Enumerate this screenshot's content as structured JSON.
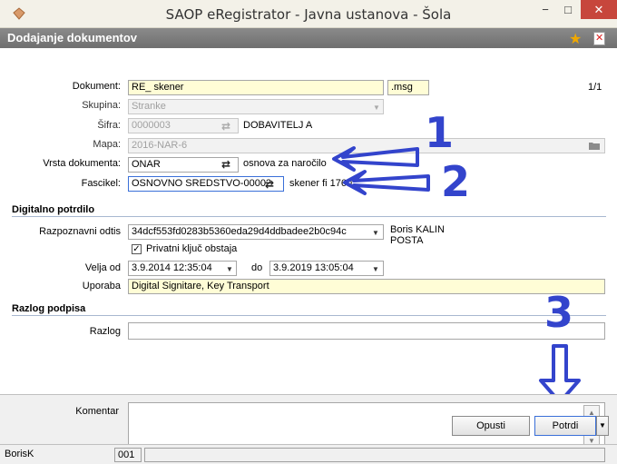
{
  "window": {
    "title": "SAOP eRegistrator - Javna ustanova - Šola",
    "minimize": "−",
    "maximize": "□",
    "close": "✕"
  },
  "header": {
    "title": "Dodajanje dokumentov"
  },
  "form": {
    "dokument": {
      "label": "Dokument:",
      "value": "RE_ skener",
      "ext": ".msg",
      "page": "1/1"
    },
    "skupina": {
      "label": "Skupina:",
      "value": "Stranke"
    },
    "sifra": {
      "label": "Šifra:",
      "value": "0000003",
      "text": "DOBAVITELJ  A"
    },
    "mapa": {
      "label": "Mapa:",
      "value": "2016-NAR-6"
    },
    "vrsta": {
      "label": "Vrsta dokumenta:",
      "value": "ONAR",
      "text": "osnova za naročilo"
    },
    "fascikel": {
      "label": "Fascikel:",
      "value": "OSNOVNO SREDSTVO-00002",
      "text": "skener fi 1760"
    }
  },
  "digital": {
    "section_title": "Digitalno potrdilo",
    "odtis": {
      "label": "Razpoznavni odtis",
      "value": "34dcf553fd0283b5360eda29d4ddbadee2b0c94c",
      "owner_line1": "Boris KALIN",
      "owner_line2": "POSTA"
    },
    "private_key": {
      "label": "Privatni ključ obstaja",
      "checked": true
    },
    "velja_od": {
      "label": "Velja od",
      "value": "3.9.2014 12:35:04"
    },
    "do": {
      "label": "do",
      "value": "3.9.2019 13:05:04"
    },
    "uporaba": {
      "label": "Uporaba",
      "value": "Digital Signitare, Key Transport"
    }
  },
  "reason": {
    "section_title": "Razlog podpisa",
    "razlog": {
      "label": "Razlog",
      "value": ""
    }
  },
  "comment": {
    "label": "Komentar",
    "value": ""
  },
  "buttons": {
    "cancel": "Opusti",
    "confirm": "Potrdi"
  },
  "status": {
    "user": "BorisK",
    "code": "001"
  },
  "annotations": {
    "n1": "1",
    "n2": "2",
    "n3": "3"
  },
  "colors": {
    "annotation": "#3344cc",
    "header_bg": "#7a7a7a",
    "yellow_field": "#fffdd6",
    "close_btn": "#c7463c"
  }
}
